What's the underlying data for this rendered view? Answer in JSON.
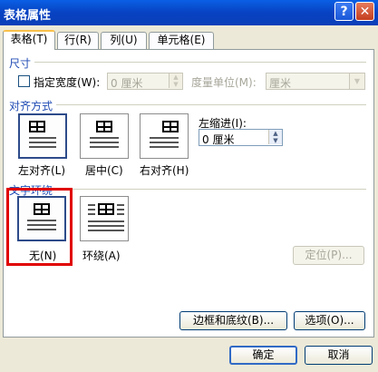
{
  "dialog": {
    "title": "表格属性",
    "help": "?",
    "close": "✕"
  },
  "tabs": [
    "表格(T)",
    "行(R)",
    "列(U)",
    "单元格(E)"
  ],
  "size": {
    "header": "尺寸",
    "specify_width": "指定宽度(W):",
    "width_value": "0 厘米",
    "unit_label": "度量单位(M):",
    "unit_value": "厘米"
  },
  "alignment": {
    "header": "对齐方式",
    "left": "左对齐(L)",
    "center": "居中(C)",
    "right": "右对齐(H)",
    "indent_label": "左缩进(I):",
    "indent_value": "0 厘米"
  },
  "wrapping": {
    "header": "文字环绕",
    "none": "无(N)",
    "around": "环绕(A)",
    "position": "定位(P)..."
  },
  "buttons": {
    "borders": "边框和底纹(B)...",
    "options": "选项(O)...",
    "ok": "确定",
    "cancel": "取消"
  },
  "icons": {
    "spin_up": "▲",
    "spin_down": "▼",
    "dropdown": "▼"
  }
}
